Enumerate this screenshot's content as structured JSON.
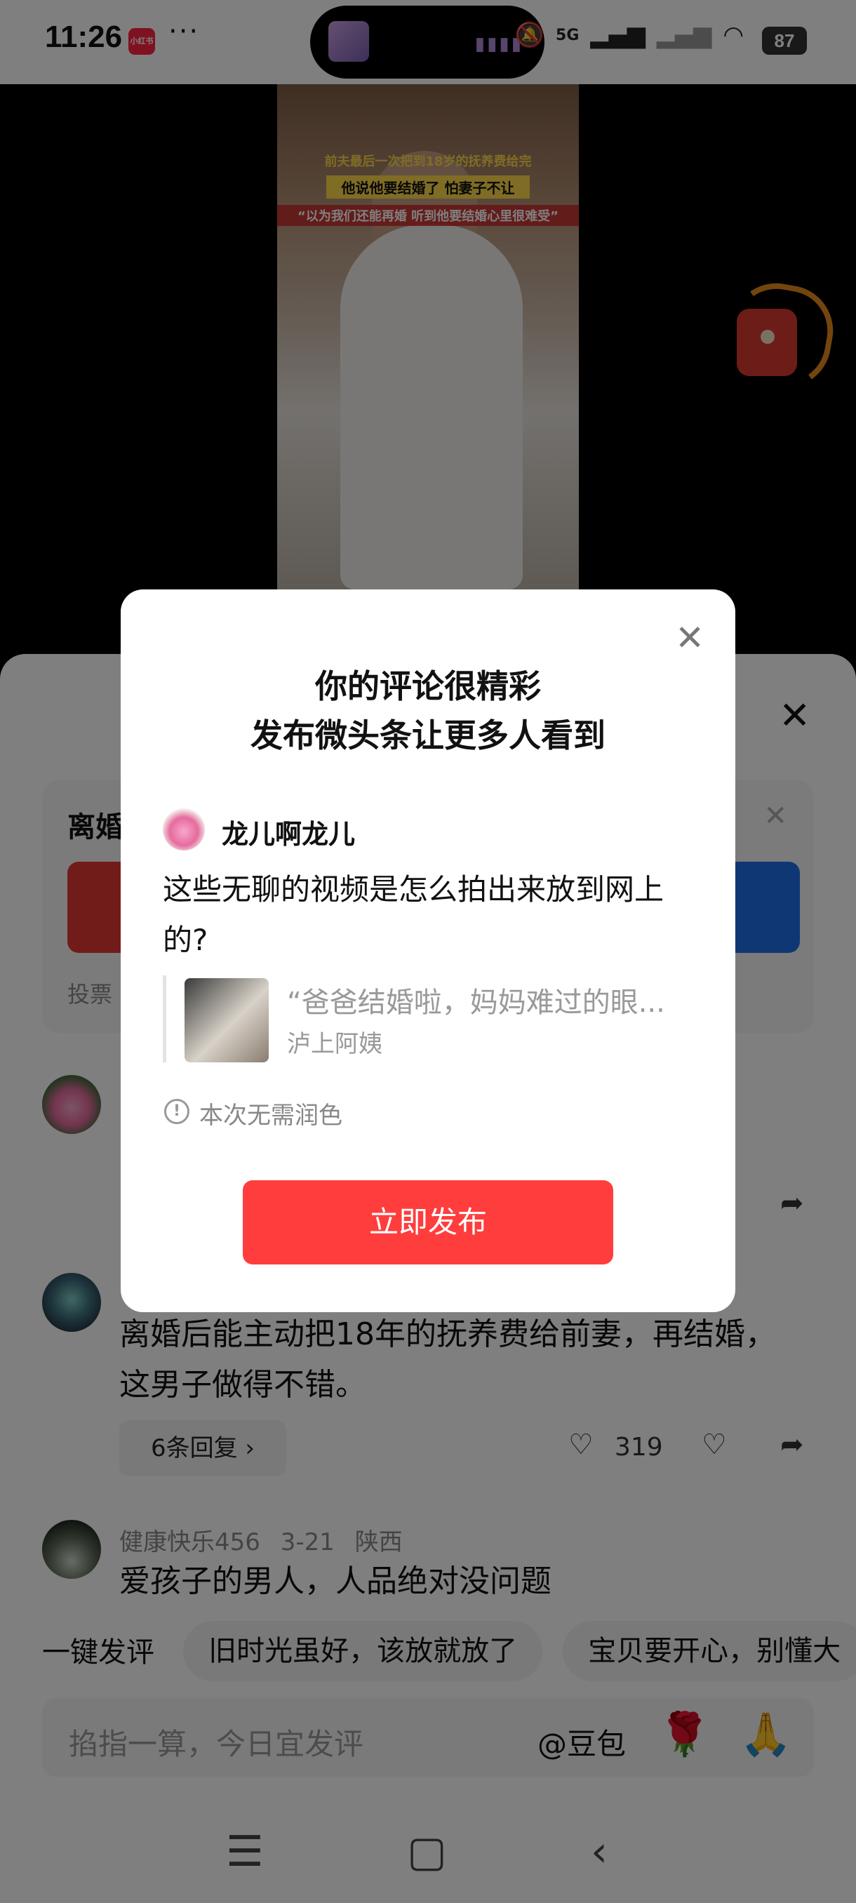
{
  "status_bar": {
    "time": "11:26",
    "app_badge": "小红书",
    "more": "···",
    "network": "5G",
    "battery": "87"
  },
  "video": {
    "caption_1": "前夫最后一次把到18岁的抚养费给完",
    "caption_2": "他说他要结婚了 怕妻子不让",
    "caption_3": "“以为我们还能再婚 听到他要结婚心里很难受”"
  },
  "vote_card": {
    "title_visible": "离婚",
    "footer_visible": "投票"
  },
  "comments": [
    {
      "text": "离婚后能主动把18年的抚养费给前妻，再结婚，这男子做得不错。",
      "replies_label": "6条回复 ›",
      "likes": "319"
    },
    {
      "username": "健康快乐456",
      "date": "3-21",
      "region": "陕西",
      "text": "爱孩子的男人，人品绝对没问题"
    }
  ],
  "quick_comment": {
    "label": "一键发评",
    "chips": [
      "旧时光虽好，该放就放了",
      "宝贝要开心，别懂大"
    ]
  },
  "input_bar": {
    "placeholder": "掐指一算，今日宜发评",
    "mention": "@豆包"
  },
  "modal": {
    "title_line1": "你的评论很精彩",
    "title_line2": "发布微头条让更多人看到",
    "username": "龙儿啊龙儿",
    "comment_text": "这些无聊的视频是怎么拍出来放到网上的?",
    "quote_title": "“爸爸结婚啦，妈妈难过的眼...",
    "quote_author": "泸上阿姨",
    "tip": "本次无需润色",
    "publish_label": "立即发布"
  },
  "colors": {
    "accent_red": "#ff3d3d",
    "vote_blue": "#1e6fe6",
    "vote_red": "#e53935"
  }
}
